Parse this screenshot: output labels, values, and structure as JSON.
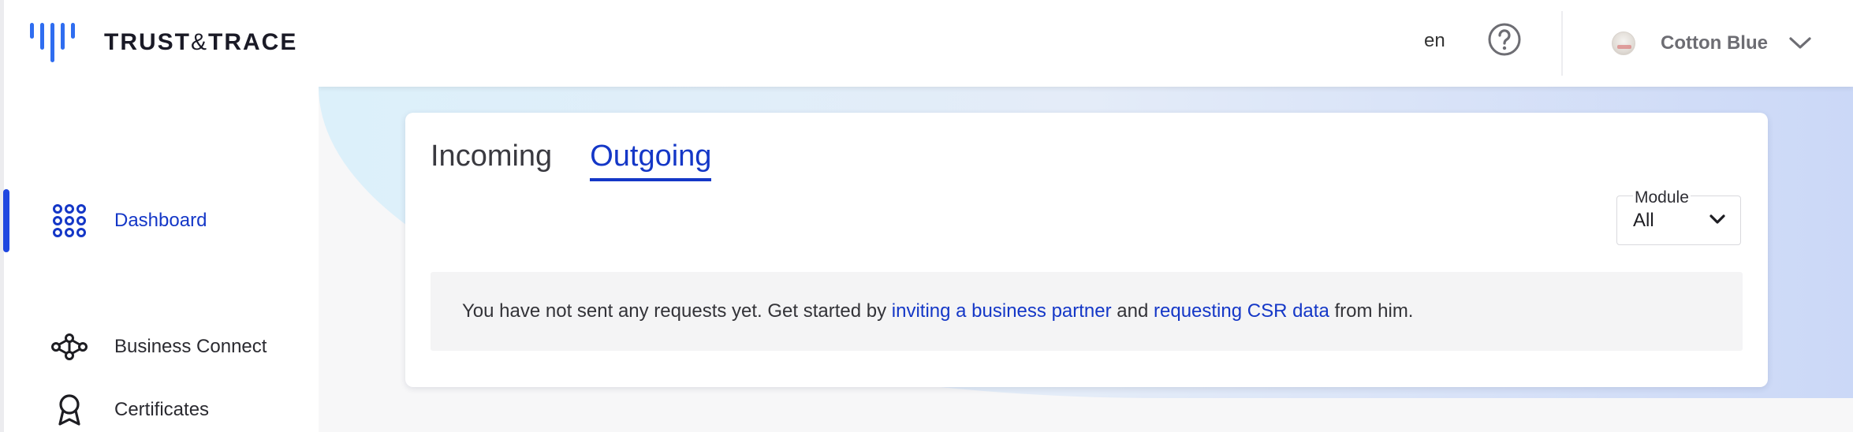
{
  "brand": {
    "name_left": "TRUST",
    "name_amp": "&",
    "name_right": "TRACE"
  },
  "sidebar": {
    "items": [
      {
        "label": "Dashboard",
        "icon": "grid-dots-icon",
        "active": true
      },
      {
        "label": "Business Connect",
        "icon": "network-icon",
        "active": false
      },
      {
        "label": "Certificates",
        "icon": "award-icon",
        "active": false
      }
    ]
  },
  "header": {
    "language": "en",
    "user_name": "Cotton Blue"
  },
  "main": {
    "tabs": [
      {
        "label": "Incoming",
        "active": false
      },
      {
        "label": "Outgoing",
        "active": true
      }
    ],
    "module_filter": {
      "label": "Module",
      "value": "All"
    },
    "empty_state": {
      "text_1": "You have not sent any requests yet. Get started by ",
      "link_1": "inviting a business partner",
      "text_2": " and ",
      "link_2": "requesting CSR data",
      "text_3": " from him."
    }
  },
  "colors": {
    "accent": "#1437c7",
    "active_bar": "#1f47e0",
    "brand_mark": "#2f6df0"
  }
}
